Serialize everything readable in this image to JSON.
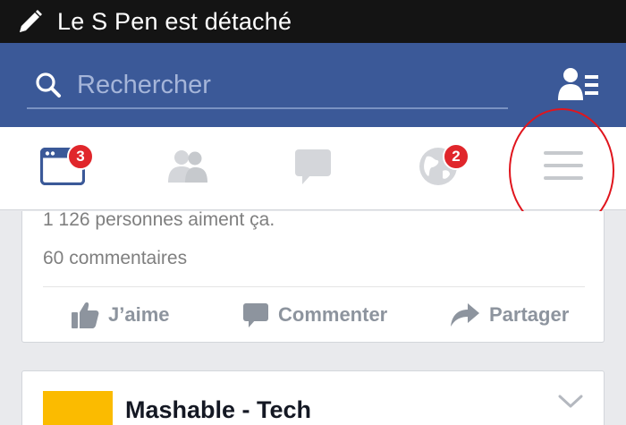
{
  "status_bar": {
    "text": "Le S Pen est détaché",
    "icon": "pencil-icon"
  },
  "header": {
    "search_placeholder": "Rechercher",
    "search_icon": "search-icon",
    "people_icon": "friend-requests-icon"
  },
  "nav": {
    "items": [
      {
        "name": "news-feed",
        "icon": "news-feed-icon",
        "badge": "3"
      },
      {
        "name": "friends",
        "icon": "friends-icon",
        "badge": ""
      },
      {
        "name": "messages",
        "icon": "chat-bubble-icon",
        "badge": ""
      },
      {
        "name": "notifications",
        "icon": "globe-icon",
        "badge": "2"
      },
      {
        "name": "more",
        "icon": "menu-icon",
        "badge": ""
      }
    ],
    "annotation_color": "#e0151d"
  },
  "post": {
    "likes_text": "1 126 personnes aiment ça.",
    "comments_text": "60 commentaires",
    "like_label": "J’aime",
    "comment_label": "Commenter",
    "share_label": "Partager"
  },
  "next_post": {
    "page_name": "Mashable - Tech",
    "logo_color": "#fbbb00"
  },
  "colors": {
    "brand": "#3b5998",
    "badge": "#e0262b",
    "status_bar": "#141414"
  }
}
